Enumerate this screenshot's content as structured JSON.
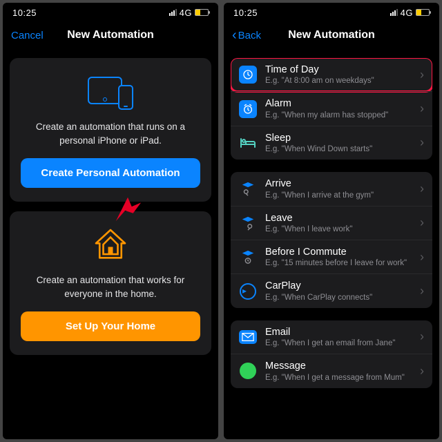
{
  "statusbar": {
    "time": "10:25",
    "network": "4G"
  },
  "left": {
    "nav": {
      "cancel": "Cancel",
      "title": "New Automation"
    },
    "personal": {
      "desc": "Create an automation that runs on a personal iPhone or iPad.",
      "button": "Create Personal Automation"
    },
    "home": {
      "desc": "Create an automation that works for everyone in the home.",
      "button": "Set Up Your Home"
    }
  },
  "right": {
    "nav": {
      "back": "Back",
      "title": "New Automation"
    },
    "triggers": {
      "time": [
        {
          "title": "Time of Day",
          "sub": "E.g. \"At 8:00 am on weekdays\""
        },
        {
          "title": "Alarm",
          "sub": "E.g. \"When my alarm has stopped\""
        },
        {
          "title": "Sleep",
          "sub": "E.g. \"When Wind Down starts\""
        }
      ],
      "location": [
        {
          "title": "Arrive",
          "sub": "E.g. \"When I arrive at the gym\""
        },
        {
          "title": "Leave",
          "sub": "E.g. \"When I leave work\""
        },
        {
          "title": "Before I Commute",
          "sub": "E.g. \"15 minutes before I leave for work\""
        },
        {
          "title": "CarPlay",
          "sub": "E.g. \"When CarPlay connects\""
        }
      ],
      "comms": [
        {
          "title": "Email",
          "sub": "E.g. \"When I get an email from Jane\""
        },
        {
          "title": "Message",
          "sub": "E.g. \"When I get a message from Mum\""
        }
      ]
    }
  }
}
